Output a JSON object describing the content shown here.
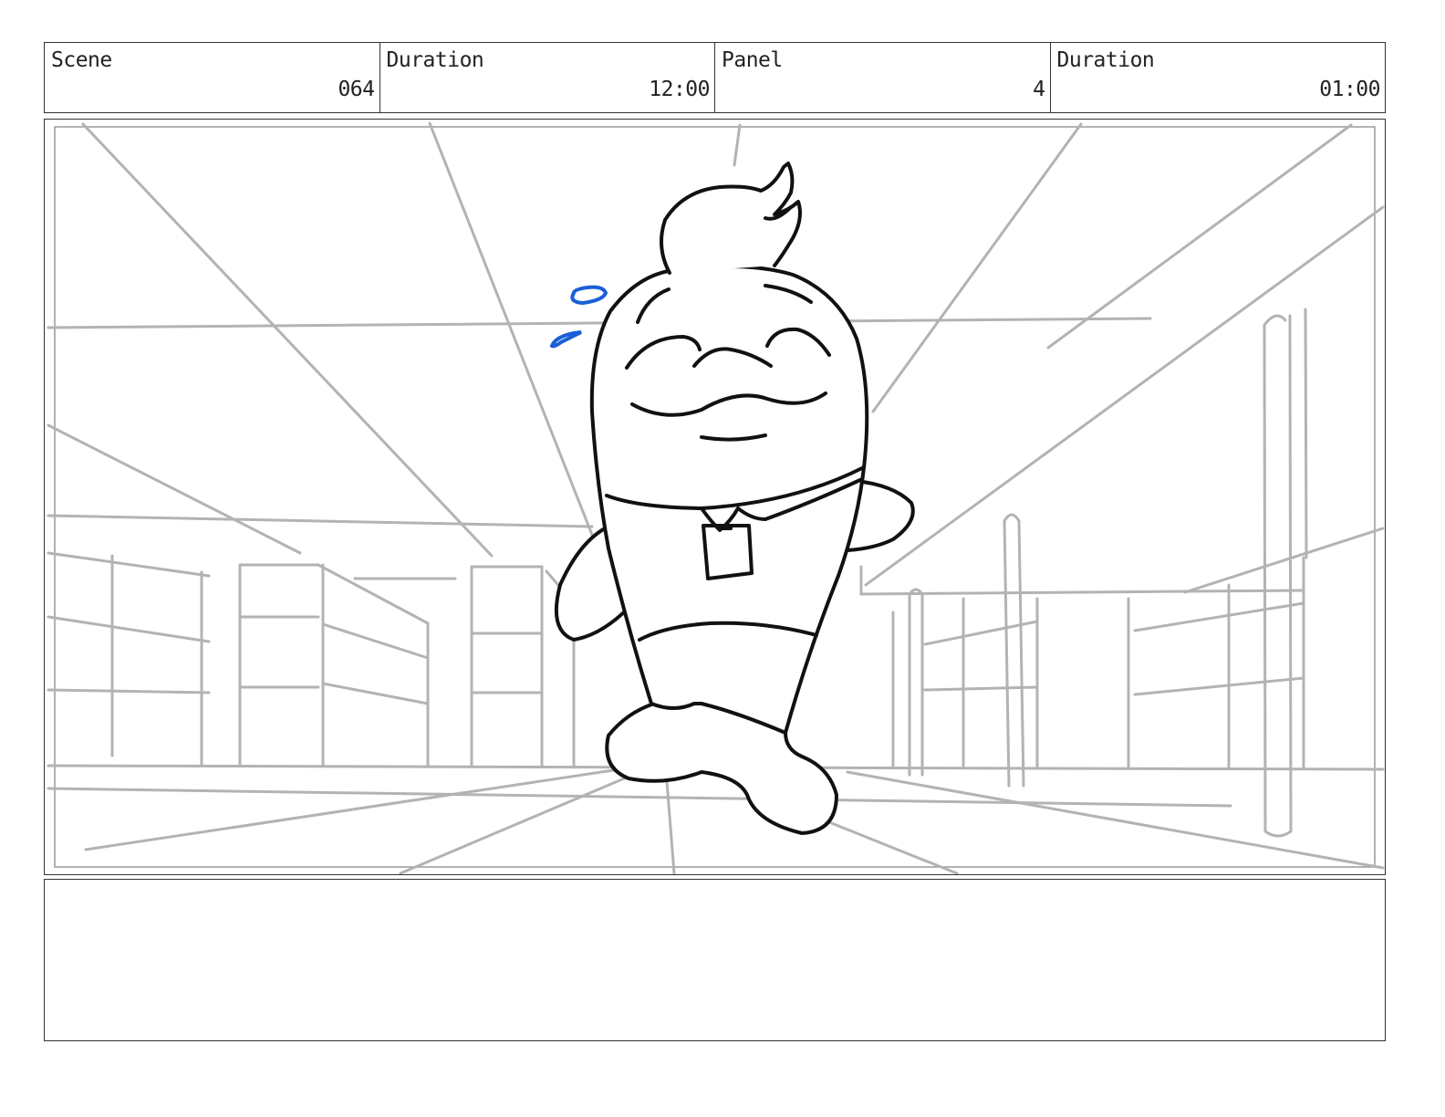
{
  "header": {
    "scene": {
      "label": "Scene",
      "value": "064"
    },
    "scene_duration": {
      "label": "Duration",
      "value": "12:00"
    },
    "panel": {
      "label": "Panel",
      "value": "4"
    },
    "panel_duration": {
      "label": "Duration",
      "value": "01:00"
    }
  },
  "notes": {
    "text": ""
  },
  "colors": {
    "sketch_line": "#111111",
    "background_line": "#b3b3b3",
    "sweat_drops": "#1a5fd6",
    "border": "#333333"
  }
}
